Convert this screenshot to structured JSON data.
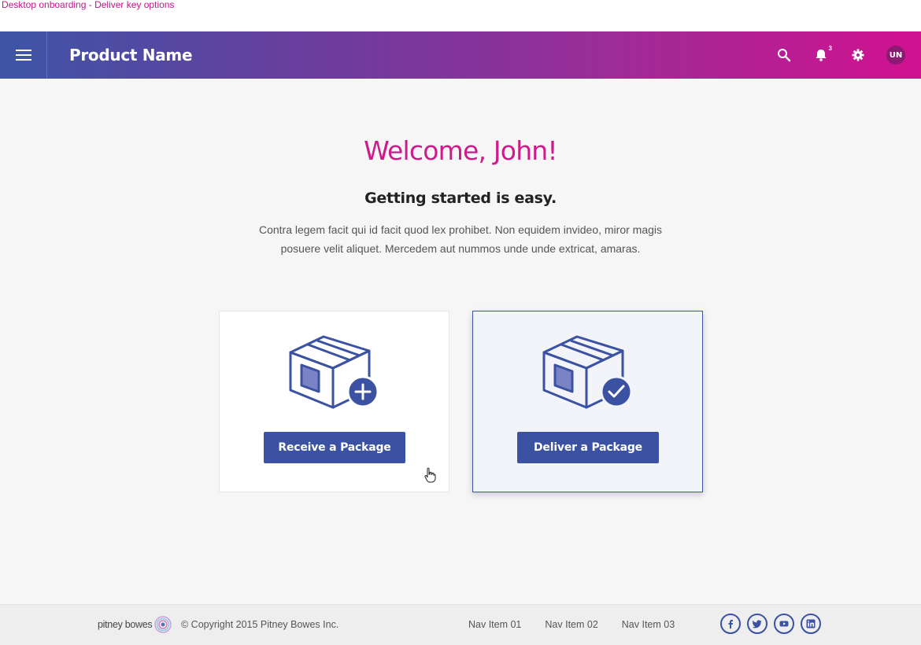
{
  "frame_label": "Desktop onboarding - Deliver key options",
  "app_bar": {
    "title": "Product Name",
    "notifications_count": "3",
    "avatar_initials": "UN",
    "icons": [
      "menu-icon",
      "search-icon",
      "bell-icon",
      "gear-icon"
    ]
  },
  "main": {
    "welcome": "Welcome, John!",
    "subhead": "Getting started is easy.",
    "blurb": "Contra legem facit qui id facit quod lex prohibet. Non equidem invideo, miror magis posuere velit aliquet. Mercedem aut nummos unde unde extricat, amaras."
  },
  "cards": [
    {
      "button_label": "Receive a Package",
      "icon": "package-add-icon",
      "selected": false
    },
    {
      "button_label": "Deliver a Package",
      "icon": "package-check-icon",
      "selected": true
    }
  ],
  "footer": {
    "logo_text": "pitney bowes",
    "copyright": "© Copyright 2015 Pitney Bowes Inc.",
    "nav": [
      "Nav Item 01",
      "Nav Item 02",
      "Nav Item 03"
    ],
    "social": [
      "facebook-icon",
      "twitter-icon",
      "youtube-icon",
      "linkedin-icon"
    ]
  },
  "colors": {
    "brand_magenta": "#cc1c8c",
    "brand_blue": "#3b52a3",
    "gradient_start": "#3d55a5",
    "gradient_end": "#d1118f"
  }
}
